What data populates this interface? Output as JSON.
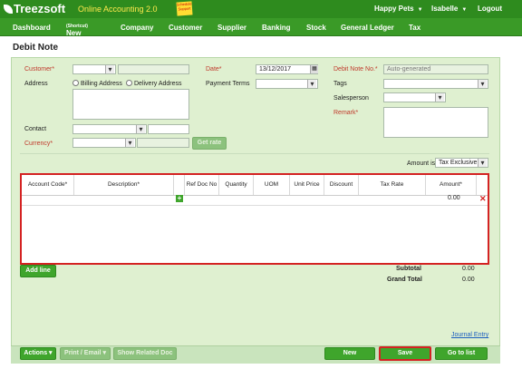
{
  "brand": {
    "name": "Treezsoft",
    "subtitle": "Online Accounting 2.0",
    "sticky_note": "Schedule Support",
    "colors": {
      "topbar": "#2e8b1e",
      "accent": "#3fa52c",
      "highlight": "#d42222"
    }
  },
  "topright": {
    "company": "Happy Pets",
    "user": "Isabelle",
    "logout": "Logout"
  },
  "menu": {
    "dashboard": "Dashboard",
    "new": "New",
    "new_sup": "(Shortcut)",
    "company": "Company",
    "customer": "Customer",
    "supplier": "Supplier",
    "banking": "Banking",
    "stock": "Stock",
    "general_ledger": "General Ledger",
    "tax": "Tax"
  },
  "page": {
    "title": "Debit Note"
  },
  "form": {
    "customer_label": "Customer*",
    "address_label": "Address",
    "billing_address": "Billing Address",
    "delivery_address": "Delivery Address",
    "contact_label": "Contact",
    "currency_label": "Currency*",
    "get_rate": "Get rate",
    "date_label": "Date*",
    "date_value": "13/12/2017",
    "payment_terms_label": "Payment Terms",
    "debit_note_no_label": "Debit Note No.*",
    "debit_note_no_value": "Auto-generated",
    "tags_label": "Tags",
    "salesperson_label": "Salesperson",
    "remark_label": "Remark*",
    "amount_is_label": "Amount is:",
    "amount_is_value": "Tax Exclusive"
  },
  "grid": {
    "columns": [
      "Account Code*",
      "Description*",
      "Ref Doc No",
      "Quantity",
      "UOM",
      "Unit Price",
      "Discount",
      "Tax Rate",
      "Amount*"
    ],
    "row_amount": "0.00"
  },
  "add_line": "Add line",
  "totals": {
    "subtotal_label": "Subtotal",
    "subtotal_value": "0.00",
    "grand_total_label": "Grand Total",
    "grand_total_value": "0.00"
  },
  "journal_entry": "Journal Entry",
  "bottom": {
    "actions": "Actions",
    "print_email": "Print / Email",
    "show_related": "Show Related Doc",
    "new": "New",
    "save": "Save",
    "go_to_list": "Go to list"
  }
}
